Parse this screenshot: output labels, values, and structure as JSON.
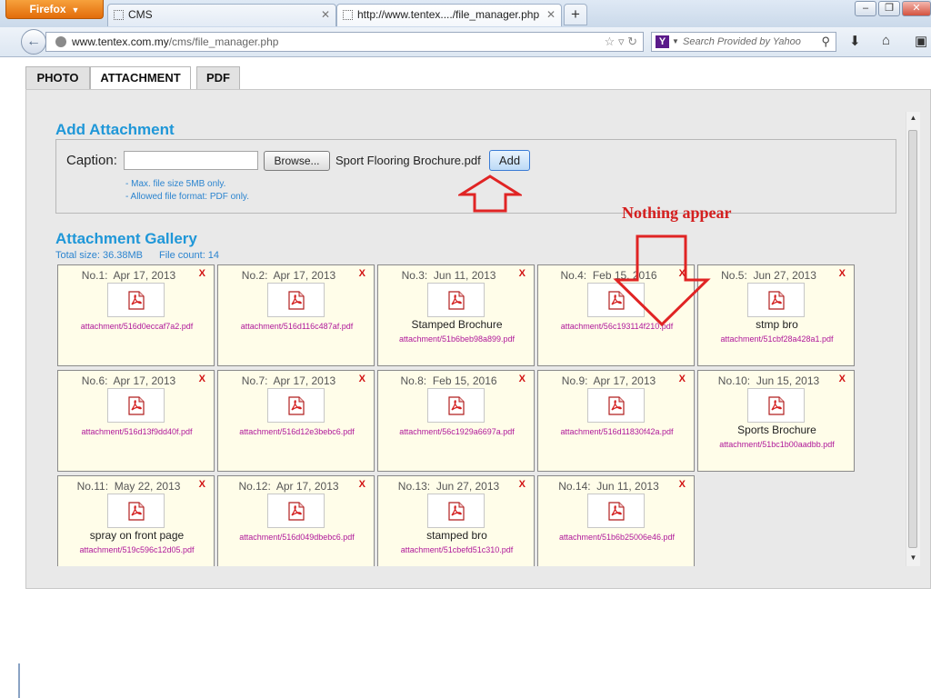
{
  "browser": {
    "menu_button": "Firefox",
    "tabs": [
      {
        "label": "CMS"
      },
      {
        "label": "http://www.tentex..../file_manager.php"
      }
    ],
    "new_tab": "+",
    "url_domain": "www.tentex.com.my",
    "url_path": "/cms/file_manager.php",
    "search_engine_icon": "Y",
    "search_placeholder": "Search Provided by Yahoo"
  },
  "page_tabs": [
    "PHOTO",
    "ATTACHMENT",
    "PDF"
  ],
  "add_attachment": {
    "title": "Add Attachment",
    "caption_label": "Caption:",
    "caption_value": "",
    "browse_label": "Browse...",
    "file_name": "Sport Flooring Brochure.pdf",
    "add_label": "Add",
    "hints": [
      "- Max. file size 5MB only.",
      "- Allowed file format: PDF only."
    ]
  },
  "gallery": {
    "title": "Attachment Gallery",
    "total_size": "Total size: 36.38MB",
    "file_count": "File count: 14",
    "delete_label": "X",
    "items": [
      {
        "no": "No.1:",
        "date": "Apr 17, 2013",
        "caption": "",
        "file": "attachment/516d0eccaf7a2.pdf"
      },
      {
        "no": "No.2:",
        "date": "Apr 17, 2013",
        "caption": "",
        "file": "attachment/516d116c487af.pdf"
      },
      {
        "no": "No.3:",
        "date": "Jun 11, 2013",
        "caption": "Stamped Brochure",
        "file": "attachment/51b6beb98a899.pdf"
      },
      {
        "no": "No.4:",
        "date": "Feb 15, 2016",
        "caption": "",
        "file": "attachment/56c193114f210.pdf"
      },
      {
        "no": "No.5:",
        "date": "Jun 27, 2013",
        "caption": "stmp bro",
        "file": "attachment/51cbf28a428a1.pdf"
      },
      {
        "no": "No.6:",
        "date": "Apr 17, 2013",
        "caption": "",
        "file": "attachment/516d13f9dd40f.pdf"
      },
      {
        "no": "No.7:",
        "date": "Apr 17, 2013",
        "caption": "",
        "file": "attachment/516d12e3bebc6.pdf"
      },
      {
        "no": "No.8:",
        "date": "Feb 15, 2016",
        "caption": "",
        "file": "attachment/56c1929a6697a.pdf"
      },
      {
        "no": "No.9:",
        "date": "Apr 17, 2013",
        "caption": "",
        "file": "attachment/516d11830f42a.pdf"
      },
      {
        "no": "No.10:",
        "date": "Jun 15, 2013",
        "caption": "Sports Brochure",
        "file": "attachment/51bc1b00aadbb.pdf"
      },
      {
        "no": "No.11:",
        "date": "May 22, 2013",
        "caption": "spray on front page",
        "file": "attachment/519c596c12d05.pdf"
      },
      {
        "no": "No.12:",
        "date": "Apr 17, 2013",
        "caption": "",
        "file": "attachment/516d049dbebc6.pdf"
      },
      {
        "no": "No.13:",
        "date": "Jun 27, 2013",
        "caption": "stamped bro",
        "file": "attachment/51cbefd51c310.pdf"
      },
      {
        "no": "No.14:",
        "date": "Jun 11, 2013",
        "caption": "",
        "file": "attachment/51b6b25006e46.pdf"
      }
    ]
  },
  "annotation": {
    "text": "Nothing appear",
    "color": "#d41f1f"
  },
  "colors": {
    "accent": "#1f97d8",
    "file_link": "#b0199a",
    "delete": "#d21212",
    "card_bg": "#fffde9"
  }
}
